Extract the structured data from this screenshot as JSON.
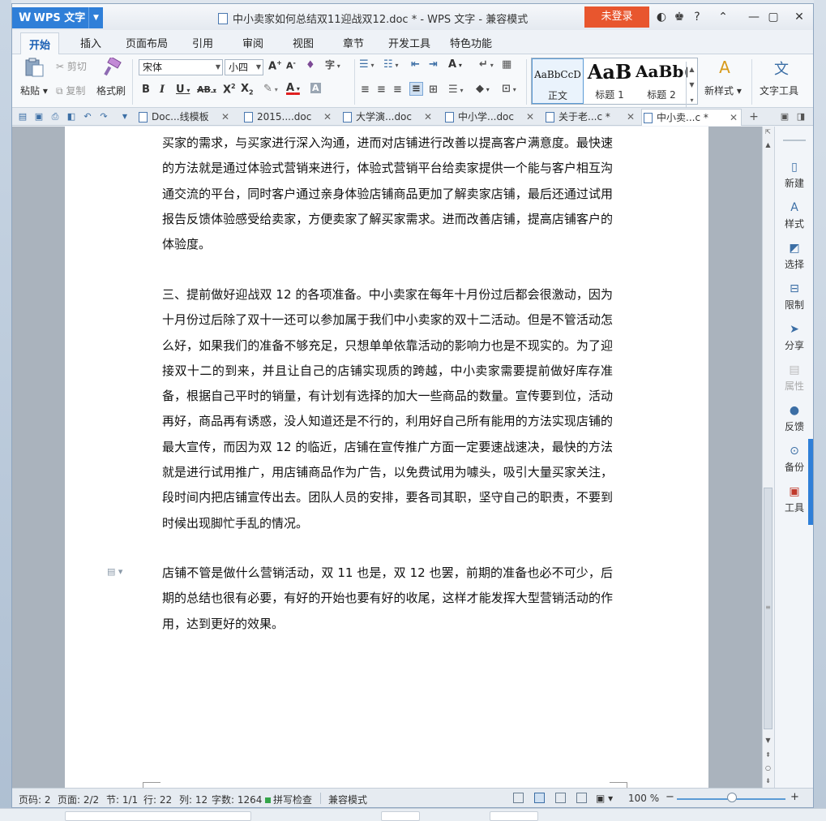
{
  "app": {
    "name": "WPS 文字",
    "title": "中小卖家如何总结双11迎战双12.doc * - WPS 文字 - 兼容模式",
    "login_label": "未登录"
  },
  "ribbon_tabs": [
    "开始",
    "插入",
    "页面布局",
    "引用",
    "审阅",
    "视图",
    "章节",
    "开发工具",
    "特色功能"
  ],
  "ribbon": {
    "paste": "粘贴",
    "cut": "剪切",
    "copy": "复制",
    "format_painter": "格式刷",
    "font_name": "宋体",
    "font_size": "小四",
    "styles": [
      {
        "sample": "AaBbCcD",
        "name": "正文"
      },
      {
        "sample": "AaB",
        "name": "标题 1"
      },
      {
        "sample": "AaBb(",
        "name": "标题 2"
      }
    ],
    "new_style": "新样式",
    "text_tools": "文字工具"
  },
  "doc_tabs": [
    {
      "label": "Doc...线模板",
      "active": false
    },
    {
      "label": "2015....doc",
      "active": false
    },
    {
      "label": "大学演...doc",
      "active": false
    },
    {
      "label": "中小学...doc",
      "active": false
    },
    {
      "label": "关于老...c *",
      "active": false
    },
    {
      "label": "中小卖...c *",
      "active": true
    }
  ],
  "document": {
    "paragraphs": [
      "买家的需求，与买家进行深入沟通，进而对店铺进行改善以提高客户满意度。最快速的方法就是通过体验式营销来进行，体验式营销平台给卖家提供一个能与客户相互沟通交流的平台，同时客户通过亲身体验店铺商品更加了解卖家店铺，最后还通过试用报告反馈体验感受给卖家，方便卖家了解买家需求。进而改善店铺，提高店铺客户的体验度。",
      "三、提前做好迎战双 12 的各项准备。中小卖家在每年十月份过后都会很激动，因为十月份过后除了双十一还可以参加属于我们中小卖家的双十二活动。但是不管活动怎么好，如果我们的准备不够充足，只想单单依靠活动的影响力也是不现实的。为了迎接双十二的到来，并且让自己的店铺实现质的跨越，中小卖家需要提前做好库存准备，根据自己平时的销量，有计划有选择的加大一些商品的数量。宣传要到位，活动再好，商品再有诱惑，没人知道还是不行的，利用好自己所有能用的方法实现店铺的最大宣传，而因为双 12 的临近，店铺在宣传推广方面一定要速战速决，最快的方法就是进行试用推广，用店铺商品作为广告，以免费试用为噱头，吸引大量买家关注，段时间内把店铺宣传出去。团队人员的安排，要各司其职，坚守自己的职责，不要到时候出现脚忙手乱的情况。",
      "店铺不管是做什么营销活动，双 11 也是，双 12 也罢，前期的准备也必不可少，后期的总结也很有必要，有好的开始也要有好的收尾，这样才能发挥大型营销活动的作用，达到更好的效果。"
    ]
  },
  "task_pane": [
    {
      "label": "新建",
      "icon": "new-doc-icon",
      "disabled": false
    },
    {
      "label": "样式",
      "icon": "style-icon",
      "disabled": false
    },
    {
      "label": "选择",
      "icon": "select-icon",
      "disabled": false
    },
    {
      "label": "限制",
      "icon": "restrict-icon",
      "disabled": false
    },
    {
      "label": "分享",
      "icon": "share-icon",
      "disabled": false
    },
    {
      "label": "属性",
      "icon": "properties-icon",
      "disabled": true
    },
    {
      "label": "反馈",
      "icon": "feedback-icon",
      "disabled": false
    },
    {
      "label": "备份",
      "icon": "backup-icon",
      "disabled": false
    },
    {
      "label": "工具",
      "icon": "toolbox-icon",
      "disabled": false
    }
  ],
  "status": {
    "page_num": "页码: 2",
    "pages": "页面: 2/2",
    "section": "节: 1/1",
    "line": "行: 22",
    "column": "列: 12",
    "word_count": "字数: 1264",
    "spell_check": "拼写检查",
    "compat_mode": "兼容模式",
    "zoom": "100 %"
  },
  "colors": {
    "accent": "#2f7fd8",
    "login": "#e8562e"
  }
}
